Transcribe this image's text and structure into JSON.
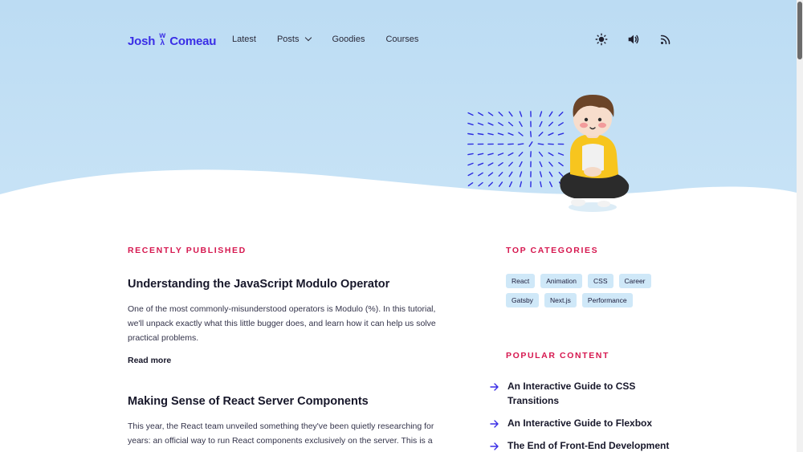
{
  "header": {
    "logo_left": "Josh",
    "logo_mark": "W\n⅄",
    "logo_right": "Comeau",
    "nav": [
      {
        "label": "Latest"
      },
      {
        "label": "Posts"
      },
      {
        "label": "Goodies"
      },
      {
        "label": "Courses"
      }
    ],
    "icons": [
      "sun-icon",
      "speaker-icon",
      "rss-icon"
    ]
  },
  "recent": {
    "label": "RECENTLY PUBLISHED",
    "posts": [
      {
        "title": "Understanding the JavaScript Modulo Operator",
        "excerpt": "One of the most commonly-misunderstood operators is Modulo (%). In this tutorial, we'll unpack exactly what this little bugger does, and learn how it can help us solve practical problems.",
        "read_more": "Read more"
      },
      {
        "title": "Making Sense of React Server Components",
        "excerpt": "This year, the React team unveiled something they've been quietly researching for years: an official way to run React components exclusively on the server. This is a"
      }
    ]
  },
  "categories": {
    "label": "TOP CATEGORIES",
    "tags": [
      "React",
      "Animation",
      "CSS",
      "Career",
      "Gatsby",
      "Next.js",
      "Performance"
    ]
  },
  "popular": {
    "label": "POPULAR CONTENT",
    "items": [
      "An Interactive Guide to CSS Transitions",
      "An Interactive Guide to Flexbox",
      "The End of Front-End Development"
    ]
  },
  "colors": {
    "accent": "#d6174f",
    "brand": "#3a2ee6",
    "hero_bg": "#c3e0f5",
    "tag_bg": "#cfe8f8"
  }
}
